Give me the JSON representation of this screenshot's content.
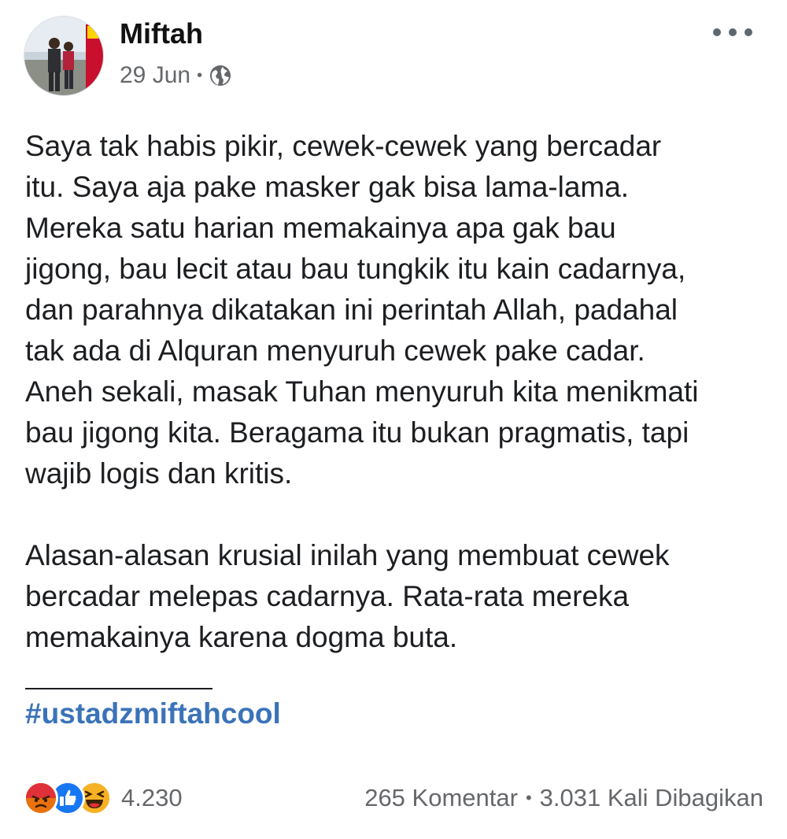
{
  "post": {
    "author": "Miftah",
    "date": "29 Jun",
    "separator": "•",
    "privacy_icon": "globe-icon",
    "body_lines": [
      "Saya tak habis pikir, cewek-cewek yang bercadar",
      "itu. Saya aja pake masker gak bisa lama-lama.",
      "Mereka satu harian memakainya apa gak bau",
      "jigong, bau lecit atau bau tungkik itu kain cadarnya,",
      "dan parahnya dikatakan ini perintah Allah, padahal",
      "tak ada di Alquran menyuruh cewek pake cadar.",
      "Aneh sekali, masak Tuhan menyuruh kita menikmati",
      "bau jigong kita. Beragama itu bukan pragmatis, tapi",
      "wajib logis dan kritis."
    ],
    "body_lines_2": [
      "Alasan-alasan krusial inilah yang membuat cewek",
      "bercadar melepas cadarnya. Rata-rata mereka",
      "memakainya karena dogma buta."
    ],
    "hashtag": "#ustadzmiftahcool"
  },
  "footer": {
    "reaction_icons": [
      "angry-icon",
      "like-icon",
      "haha-icon"
    ],
    "reaction_count": "4.230",
    "comments": "265 Komentar",
    "separator": "•",
    "shares": "3.031 Kali Dibagikan"
  },
  "colors": {
    "text": "#1c1e21",
    "secondary": "#65676b",
    "hashtag": "#3b73b9",
    "like": "#1877f2",
    "angry": "#e9710f",
    "haha": "#f7b125"
  }
}
